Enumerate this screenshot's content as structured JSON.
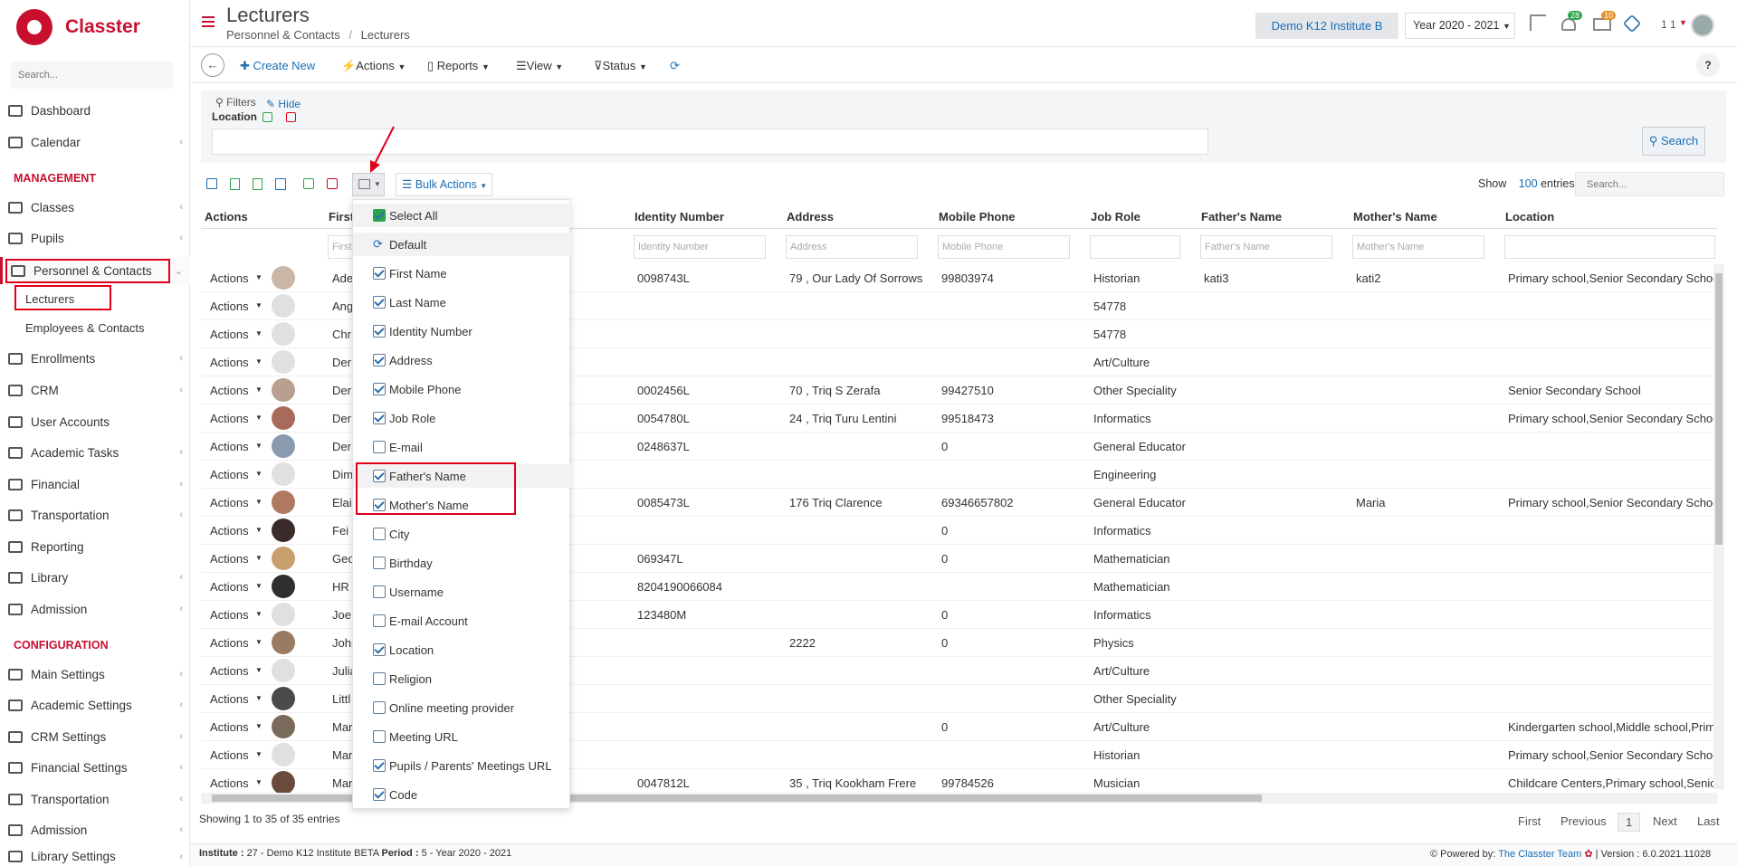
{
  "app": {
    "name": "Classter"
  },
  "sidebar": {
    "search_placeholder": "Search...",
    "items": [
      {
        "label": "Dashboard"
      },
      {
        "label": "Calendar"
      },
      {
        "label": "Classes"
      },
      {
        "label": "Pupils"
      },
      {
        "label": "Personnel & Contacts"
      },
      {
        "label": "Enrollments"
      },
      {
        "label": "CRM"
      },
      {
        "label": "User Accounts"
      },
      {
        "label": "Academic Tasks"
      },
      {
        "label": "Financial"
      },
      {
        "label": "Transportation"
      },
      {
        "label": "Reporting"
      },
      {
        "label": "Library"
      },
      {
        "label": "Admission"
      }
    ],
    "sub": {
      "lecturers": "Lecturers",
      "employees": "Employees & Contacts"
    },
    "heading_management": "MANAGEMENT",
    "heading_configuration": "CONFIGURATION",
    "config_items": [
      {
        "label": "Main Settings"
      },
      {
        "label": "Academic Settings"
      },
      {
        "label": "CRM Settings"
      },
      {
        "label": "Financial Settings"
      },
      {
        "label": "Transportation"
      },
      {
        "label": "Admission"
      },
      {
        "label": "Library Settings"
      }
    ]
  },
  "header": {
    "title": "Lecturers",
    "breadcrumb_parent": "Personnel & Contacts",
    "breadcrumb_sep": "/",
    "breadcrumb_current": "Lecturers",
    "institute": "Demo K12 Institute B",
    "year": "Year 2020 - 2021",
    "badge_tasks": "28",
    "badge_mail": "10",
    "user_count": "1 1"
  },
  "toolbar": {
    "create": "Create New",
    "actions": "Actions",
    "reports": "Reports",
    "view": "View",
    "status": "Status",
    "help": "?"
  },
  "filters": {
    "label": "Filters",
    "hide": "Hide",
    "location": "Location",
    "search_btn": "Search"
  },
  "grid": {
    "bulk_actions": "Bulk Actions",
    "show": "Show",
    "entries_count": "100",
    "entries": "entries",
    "search_placeholder": "Search...",
    "headers": {
      "actions": "Actions",
      "first": "First",
      "identity": "Identity Number",
      "address": "Address",
      "mobile": "Mobile Phone",
      "job": "Job Role",
      "father": "Father's Name",
      "mother": "Mother's Name",
      "location": "Location"
    },
    "filter_placeholders": {
      "first": "First",
      "identity": "Identity Number",
      "address": "Address",
      "mobile": "Mobile Phone",
      "father": "Father's Name",
      "mother": "Mother's Name"
    },
    "action_label": "Actions",
    "rows": [
      {
        "first": "Ade",
        "id": "0098743L",
        "addr": "79 , Our Lady Of Sorrows",
        "mob": "99803974",
        "job": "Historian",
        "father": "kati3",
        "mother": "kati2",
        "loc": "Primary school,Senior Secondary School"
      },
      {
        "first": "Ang",
        "id": "",
        "addr": "",
        "mob": "",
        "job": "54778",
        "father": "",
        "mother": "",
        "loc": ""
      },
      {
        "first": "Chr",
        "id": "",
        "addr": "",
        "mob": "",
        "job": "54778",
        "father": "",
        "mother": "",
        "loc": ""
      },
      {
        "first": "Der",
        "id": "",
        "addr": "",
        "mob": "",
        "job": "Art/Culture",
        "father": "",
        "mother": "",
        "loc": ""
      },
      {
        "first": "Der",
        "id": "0002456L",
        "addr": "70 , Triq S Zerafa",
        "mob": "99427510",
        "job": "Other Speciality",
        "father": "",
        "mother": "",
        "loc": "Senior Secondary School"
      },
      {
        "first": "Der",
        "id": "0054780L",
        "addr": "24 , Triq Turu Lentini",
        "mob": "99518473",
        "job": "Informatics",
        "father": "",
        "mother": "",
        "loc": "Primary school,Senior Secondary School"
      },
      {
        "first": "Der",
        "id": "0248637L",
        "addr": "",
        "mob": "0",
        "job": "General Educator",
        "father": "",
        "mother": "",
        "loc": ""
      },
      {
        "first": "Dim",
        "id": "",
        "addr": "",
        "mob": "",
        "job": "Engineering",
        "father": "",
        "mother": "",
        "loc": ""
      },
      {
        "first": "Elai",
        "id": "0085473L",
        "addr": "176 Triq Clarence",
        "mob": "69346657802",
        "job": "General Educator",
        "father": "",
        "mother": "Maria",
        "loc": "Primary school,Senior Secondary School"
      },
      {
        "first": "Fei",
        "id": "",
        "addr": "",
        "mob": "0",
        "job": "Informatics",
        "father": "",
        "mother": "",
        "loc": ""
      },
      {
        "first": "Geo",
        "id": "069347L",
        "addr": "",
        "mob": "0",
        "job": "Mathematician",
        "father": "",
        "mother": "",
        "loc": ""
      },
      {
        "first": "HR",
        "id": "8204190066084",
        "addr": "",
        "mob": "",
        "job": "Mathematician",
        "father": "",
        "mother": "",
        "loc": ""
      },
      {
        "first": "Joe",
        "id": "123480M",
        "addr": "",
        "mob": "0",
        "job": "Informatics",
        "father": "",
        "mother": "",
        "loc": ""
      },
      {
        "first": "Johr",
        "id": "",
        "addr": "2222",
        "mob": "0",
        "job": "Physics",
        "father": "",
        "mother": "",
        "loc": ""
      },
      {
        "first": "Julia",
        "id": "",
        "addr": "",
        "mob": "",
        "job": "Art/Culture",
        "father": "",
        "mother": "",
        "loc": ""
      },
      {
        "first": "Littl",
        "id": "",
        "addr": "",
        "mob": "",
        "job": "Other Speciality",
        "father": "",
        "mother": "",
        "loc": ""
      },
      {
        "first": "Mar",
        "id": "",
        "addr": "",
        "mob": "0",
        "job": "Art/Culture",
        "father": "",
        "mother": "",
        "loc": "Kindergarten school,Middle school,Prim"
      },
      {
        "first": "Mar",
        "id": "",
        "addr": "",
        "mob": "",
        "job": "Historian",
        "father": "",
        "mother": "",
        "loc": "Primary school,Senior Secondary School"
      },
      {
        "first": "Mar",
        "id": "0047812L",
        "addr": "35 , Triq Kookham Frere",
        "mob": "99784526",
        "job": "Musician",
        "father": "",
        "mother": "",
        "loc": "Childcare Centers,Primary school,Senic"
      }
    ],
    "showing": "Showing 1 to 35 of 35 entries",
    "pager": {
      "first": "First",
      "previous": "Previous",
      "page": "1",
      "next": "Next",
      "last": "Last"
    }
  },
  "column_menu": {
    "select_all": "Select All",
    "default": "Default",
    "items": [
      {
        "label": "First Name",
        "checked": true
      },
      {
        "label": "Last Name",
        "checked": true
      },
      {
        "label": "Identity Number",
        "checked": true
      },
      {
        "label": "Address",
        "checked": true
      },
      {
        "label": "Mobile Phone",
        "checked": true
      },
      {
        "label": "Job Role",
        "checked": true
      },
      {
        "label": "E-mail",
        "checked": false
      },
      {
        "label": "Father's Name",
        "checked": true
      },
      {
        "label": "Mother's Name",
        "checked": true
      },
      {
        "label": "City",
        "checked": false
      },
      {
        "label": "Birthday",
        "checked": false
      },
      {
        "label": "Username",
        "checked": false
      },
      {
        "label": "E-mail Account",
        "checked": false
      },
      {
        "label": "Location",
        "checked": true
      },
      {
        "label": "Religion",
        "checked": false
      },
      {
        "label": "Online meeting provider",
        "checked": false
      },
      {
        "label": "Meeting URL",
        "checked": false
      },
      {
        "label": "Pupils / Parents' Meetings URL",
        "checked": true
      },
      {
        "label": "Code",
        "checked": true
      }
    ]
  },
  "footer": {
    "institute_label": "Institute :",
    "institute_value": "27 - Demo K12 Institute BETA",
    "period_label": "Period :",
    "period_value": "5 - Year 2020 - 2021",
    "powered": "Powered by:",
    "team": "The Classter Team",
    "version": "| Version : 6.0.2021.11028"
  },
  "colors": {
    "brand": "#c8102e",
    "link": "#1a6fb5",
    "highlight": "#e0001a"
  }
}
